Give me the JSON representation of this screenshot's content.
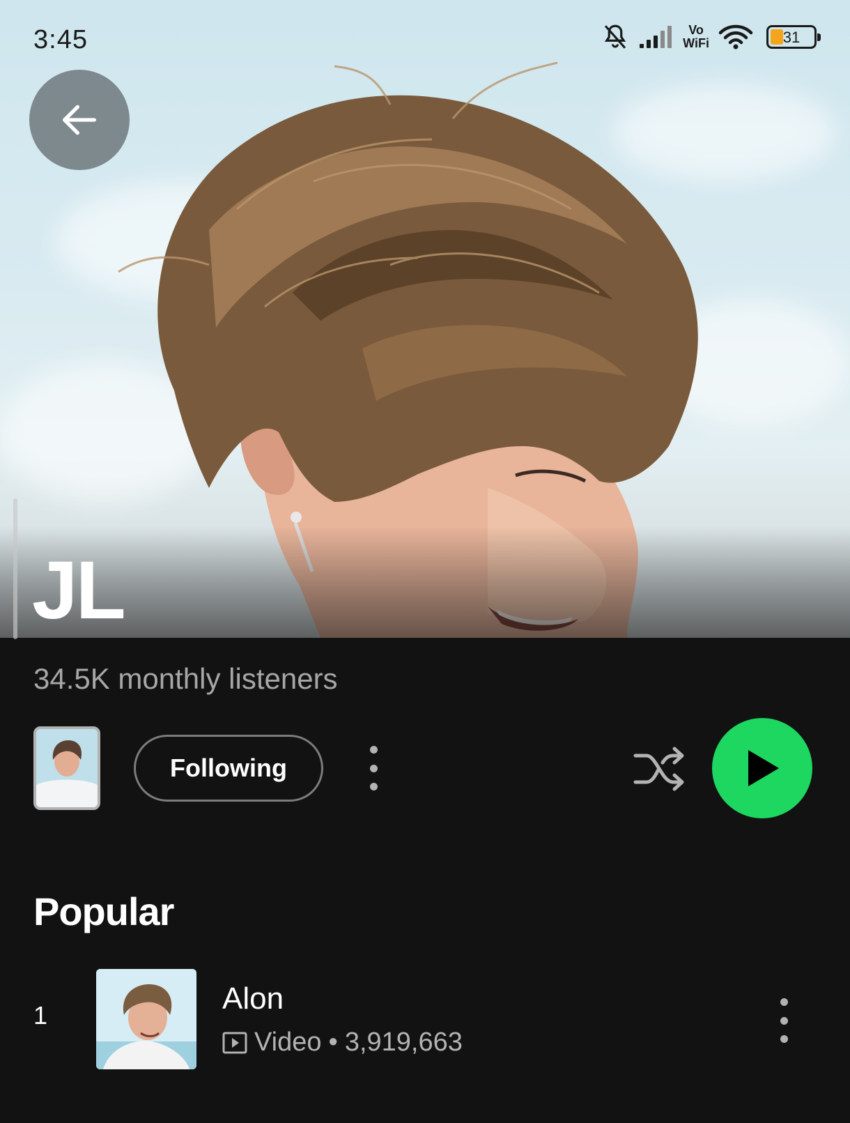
{
  "status_bar": {
    "time": "3:45",
    "network_label_top": "Vo",
    "network_label_bottom": "WiFi",
    "battery_level": "31",
    "icons": [
      "bell-off-icon",
      "signal-icon",
      "wifi-icon",
      "battery-icon"
    ]
  },
  "header": {
    "back_icon": "arrow-left-icon"
  },
  "artist": {
    "name": "JL",
    "monthly_listeners": "34.5K monthly listeners"
  },
  "actions": {
    "follow_label": "Following",
    "more_icon": "more-vertical-icon",
    "shuffle_icon": "shuffle-icon",
    "play_icon": "play-icon"
  },
  "popular": {
    "title": "Popular",
    "tracks": [
      {
        "rank": "1",
        "title": "Alon",
        "type": "Video",
        "separator": "•",
        "plays": "3,919,663"
      }
    ]
  },
  "colors": {
    "background": "#121212",
    "accent_green": "#1ed760",
    "secondary_text": "#a7a7a7",
    "battery_fill": "#f4a51c"
  }
}
